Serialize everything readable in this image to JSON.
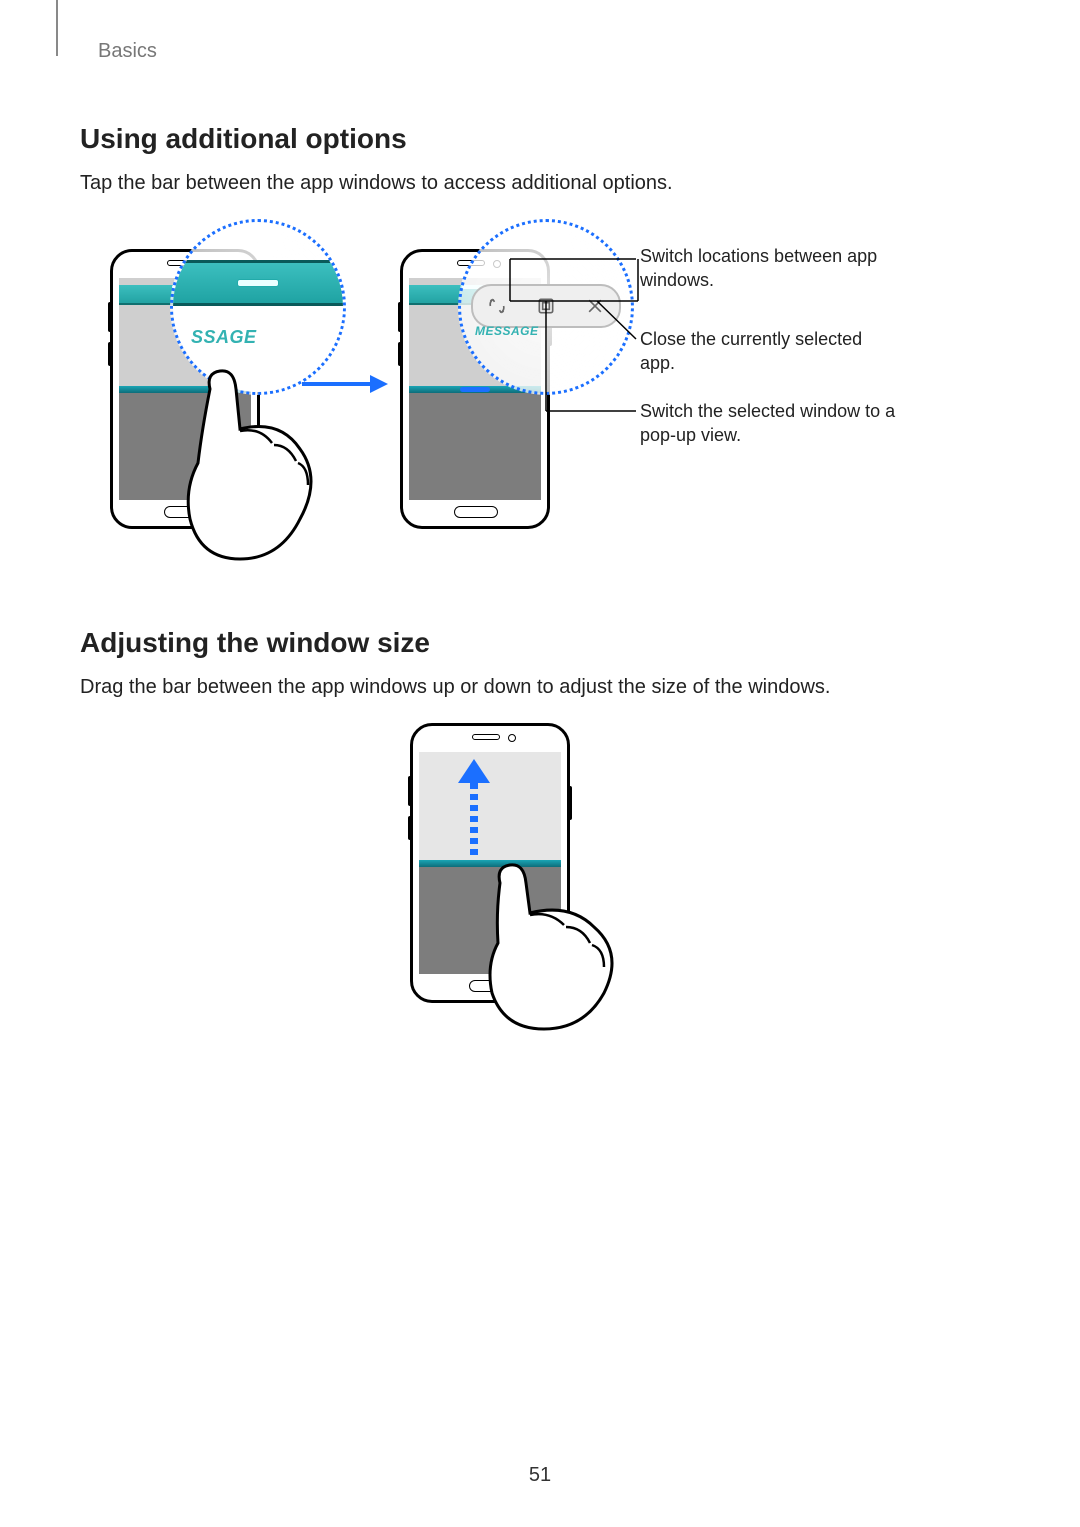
{
  "header": {
    "breadcrumb": "Basics"
  },
  "section1": {
    "title": "Using additional options",
    "body": "Tap the bar between the app windows to access additional options."
  },
  "figure1": {
    "left_zoom_text": "SSAGE",
    "right_zoom_text": "MESSAGE",
    "callout_switch": "Switch locations between app windows.",
    "callout_close": "Close the currently selected app.",
    "callout_popup": "Switch the selected window to a pop-up view."
  },
  "section2": {
    "title": "Adjusting the window size",
    "body": "Drag the bar between the app windows up or down to adjust the size of the windows."
  },
  "page_number": "51"
}
